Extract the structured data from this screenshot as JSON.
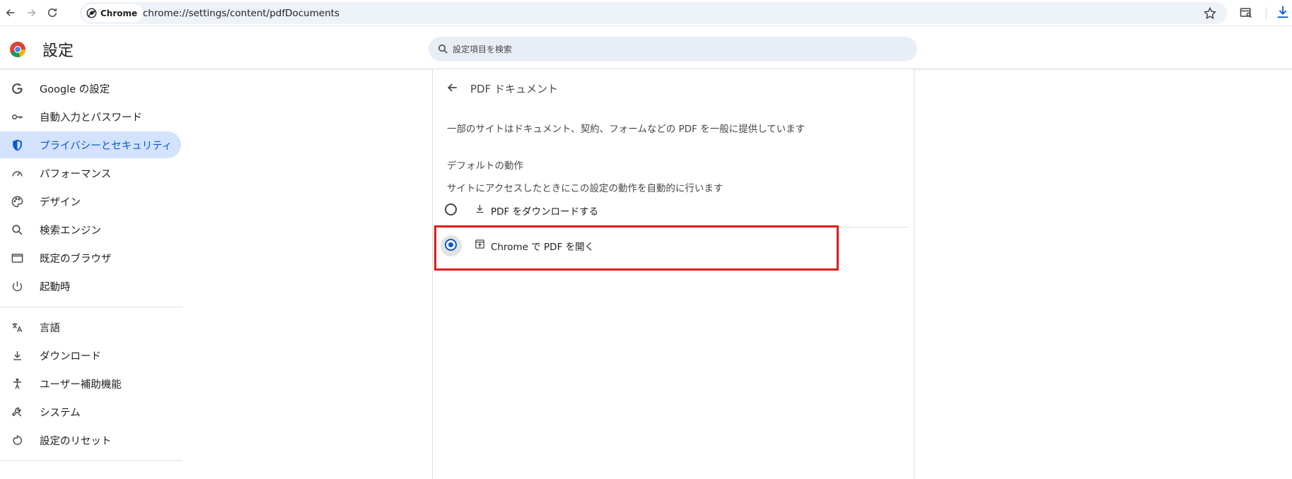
{
  "browser": {
    "chip_label": "Chrome",
    "url": "chrome://settings/content/pdfDocuments"
  },
  "header": {
    "title": "設定",
    "search_placeholder": "設定項目を検索"
  },
  "sidebar": {
    "items": [
      {
        "label": "Google の設定",
        "icon": "google-icon"
      },
      {
        "label": "自動入力とパスワード",
        "icon": "key-icon"
      },
      {
        "label": "プライバシーとセキュリティ",
        "icon": "shield-icon",
        "active": true
      },
      {
        "label": "パフォーマンス",
        "icon": "speedometer-icon"
      },
      {
        "label": "デザイン",
        "icon": "palette-icon"
      },
      {
        "label": "検索エンジン",
        "icon": "search-icon"
      },
      {
        "label": "既定のブラウザ",
        "icon": "browser-window-icon"
      },
      {
        "label": "起動時",
        "icon": "power-icon"
      },
      {
        "label": "言語",
        "icon": "translate-icon"
      },
      {
        "label": "ダウンロード",
        "icon": "download-icon"
      },
      {
        "label": "ユーザー補助機能",
        "icon": "accessibility-icon"
      },
      {
        "label": "システム",
        "icon": "wrench-icon"
      },
      {
        "label": "設定のリセット",
        "icon": "reset-icon"
      }
    ]
  },
  "main": {
    "title": "PDF ドキュメント",
    "description": "一部のサイトはドキュメント、契約、フォームなどの PDF を一般に提供しています",
    "section_title": "デフォルトの動作",
    "section_subtitle": "サイトにアクセスしたときにこの設定の動作を自動的に行います",
    "options": [
      {
        "label": "PDF をダウンロードする",
        "icon": "download-icon",
        "checked": false
      },
      {
        "label": "Chrome で PDF を開く",
        "icon": "open-in-new-icon",
        "checked": true
      }
    ]
  },
  "colors": {
    "accent": "#0b57d0",
    "active_bg": "#d3e3fd",
    "highlight": "#e01b1b"
  }
}
